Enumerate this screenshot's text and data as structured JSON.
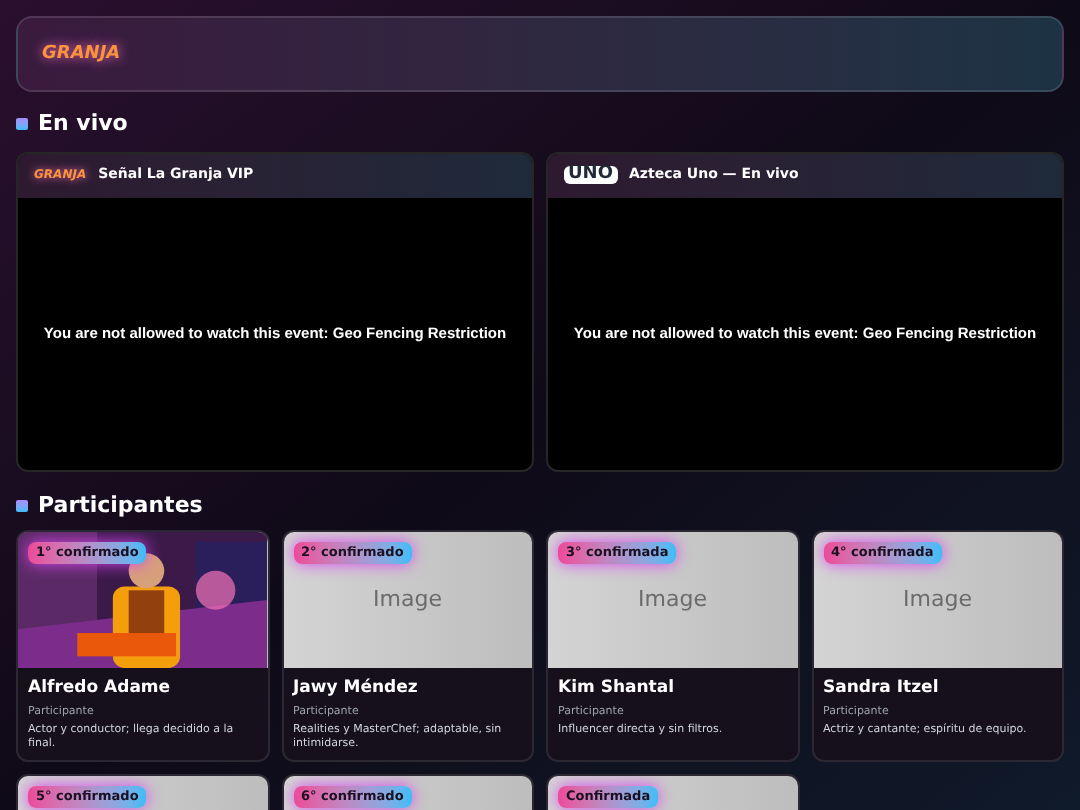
{
  "header": {
    "logo": "GRANJA"
  },
  "live_section": {
    "title": "En vivo"
  },
  "streams": [
    {
      "kind": "granja",
      "logo": "GRANJA",
      "title": "Señal La Granja VIP",
      "message": "You are not allowed to watch this event: Geo Fencing Restriction"
    },
    {
      "kind": "uno",
      "logo": "UNO",
      "title": "Azteca Uno — En vivo",
      "message": "You are not allowed to watch this event: Geo Fencing Restriction"
    }
  ],
  "participants_section": {
    "title": "Participantes"
  },
  "participants": [
    {
      "kind": "picture",
      "badge": "1° confirmado",
      "name": "Alfredo Adame",
      "role": "Participante",
      "bio": "Actor y conductor; llega decidido a la final."
    },
    {
      "kind": "placeholder",
      "image_label": "Image",
      "badge": "2° confirmado",
      "name": "Jawy Méndez",
      "role": "Participante",
      "bio": "Realities y MasterChef; adaptable, sin intimidarse."
    },
    {
      "kind": "placeholder",
      "image_label": "Image",
      "badge": "3° confirmada",
      "name": "Kim Shantal",
      "role": "Participante",
      "bio": "Influencer directa y sin filtros."
    },
    {
      "kind": "placeholder",
      "image_label": "Image",
      "badge": "4° confirmada",
      "name": "Sandra Itzel",
      "role": "Participante",
      "bio": "Actriz y cantante; espíritu de equipo."
    },
    {
      "kind": "cut",
      "badge": "5° confirmado"
    },
    {
      "kind": "cut",
      "badge": "6° confirmado"
    },
    {
      "kind": "cut",
      "badge": "Confirmada"
    }
  ]
}
